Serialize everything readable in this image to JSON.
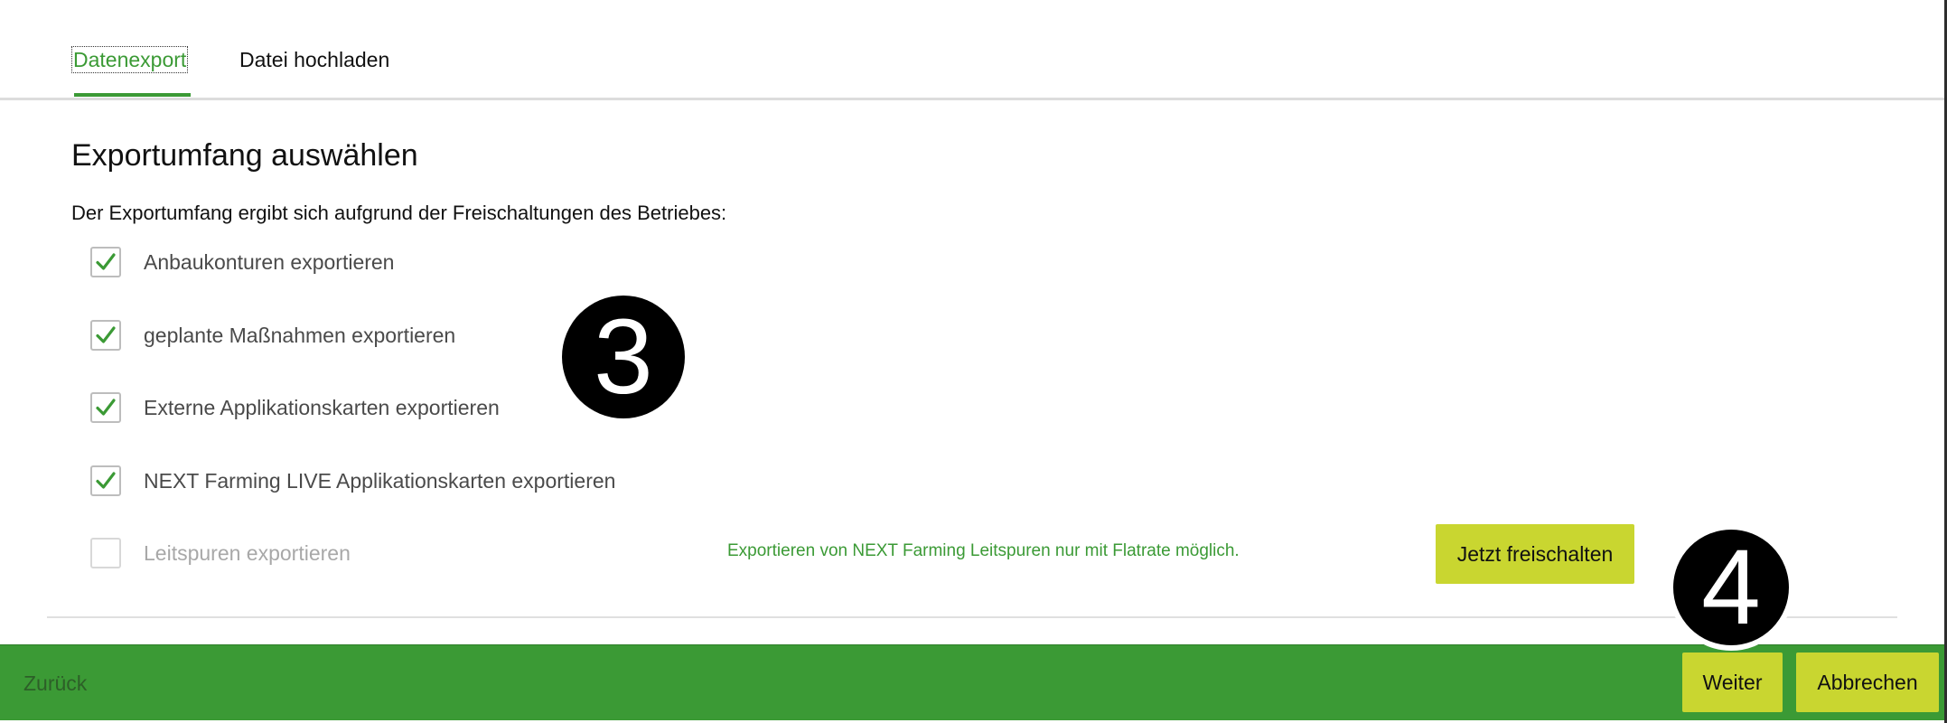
{
  "tabs": {
    "active": "Datenexport",
    "inactive": "Datei hochladen"
  },
  "section": {
    "title": "Exportumfang auswählen",
    "description": "Der Exportumfang ergibt sich aufgrund der Freischaltungen des Betriebes:"
  },
  "options": [
    {
      "label": "Anbaukonturen exportieren",
      "checked": true,
      "enabled": true
    },
    {
      "label": "geplante Maßnahmen exportieren",
      "checked": true,
      "enabled": true
    },
    {
      "label": "Externe Applikationskarten exportieren",
      "checked": true,
      "enabled": true
    },
    {
      "label": "NEXT Farming LIVE Applikationskarten exportieren",
      "checked": true,
      "enabled": true
    },
    {
      "label": "Leitspuren exportieren",
      "checked": false,
      "enabled": false
    }
  ],
  "upsell": {
    "note": "Exportieren von NEXT Farming Leitspuren nur mit Flatrate möglich.",
    "button_label": "Jetzt freischalten"
  },
  "footer": {
    "back_label": "Zurück",
    "next_label": "Weiter",
    "cancel_label": "Abbrechen"
  },
  "annotations": {
    "step_a": "3",
    "step_b": "4"
  },
  "colors": {
    "brand_green": "#3b9a35",
    "button_lime": "#c9d630",
    "check_green": "#3b9a35"
  },
  "icons": {
    "checkmark": "checkmark-icon"
  }
}
